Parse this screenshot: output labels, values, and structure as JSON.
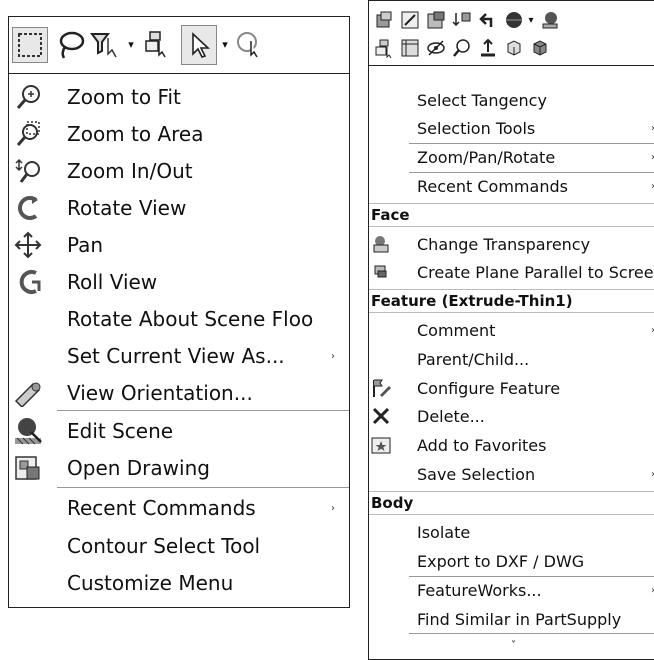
{
  "left_menu": {
    "items": [
      {
        "label": "Zoom to Fit",
        "icon": "zoom-to-fit-icon"
      },
      {
        "label": "Zoom to Area",
        "icon": "zoom-to-area-icon"
      },
      {
        "label": "Zoom In/Out",
        "icon": "zoom-in-out-icon"
      },
      {
        "label": "Rotate View",
        "icon": "rotate-view-icon"
      },
      {
        "label": "Pan",
        "icon": "pan-icon"
      },
      {
        "label": "Roll View",
        "icon": "roll-view-icon"
      },
      {
        "label": "Rotate About Scene Floo",
        "icon": ""
      },
      {
        "label": "Set Current View As...",
        "icon": "",
        "submenu": true
      },
      {
        "label": "View Orientation...",
        "icon": "view-orientation-icon"
      },
      {
        "label": "Edit Scene",
        "icon": "edit-scene-icon"
      },
      {
        "label": "Open Drawing",
        "icon": "open-drawing-icon"
      },
      {
        "label": "Recent Commands",
        "icon": "",
        "submenu": true
      },
      {
        "label": "Contour Select Tool",
        "icon": ""
      },
      {
        "label": "Customize Menu",
        "icon": ""
      }
    ]
  },
  "right_menu": {
    "items": [
      {
        "label": "Select Tangency"
      },
      {
        "label": "Selection Tools",
        "submenu": true
      },
      {
        "label": "Zoom/Pan/Rotate",
        "submenu": true
      },
      {
        "label": "Recent Commands",
        "submenu": true
      }
    ],
    "face_header": "Face",
    "face_items": [
      {
        "label": "Change Transparency",
        "icon": "change-transparency-icon"
      },
      {
        "label": "Create Plane Parallel to Scree",
        "icon": "create-plane-icon"
      }
    ],
    "feature_header": "Feature (Extrude-Thin1)",
    "feature_items": [
      {
        "label": "Comment",
        "submenu": true
      },
      {
        "label": "Parent/Child..."
      },
      {
        "label": "Configure Feature",
        "icon": "configure-feature-icon"
      },
      {
        "label": "Delete...",
        "icon": "delete-icon"
      },
      {
        "label": "Add to Favorites",
        "icon": "favorites-icon"
      },
      {
        "label": "Save Selection",
        "submenu": true
      }
    ],
    "body_header": "Body",
    "body_items": [
      {
        "label": "Isolate"
      },
      {
        "label": "Export to DXF / DWG"
      },
      {
        "label": "FeatureWorks...",
        "submenu": true
      },
      {
        "label": "Find Similar in PartSupply"
      }
    ]
  },
  "submenu_arrow": "›",
  "more_arrow": "˅"
}
